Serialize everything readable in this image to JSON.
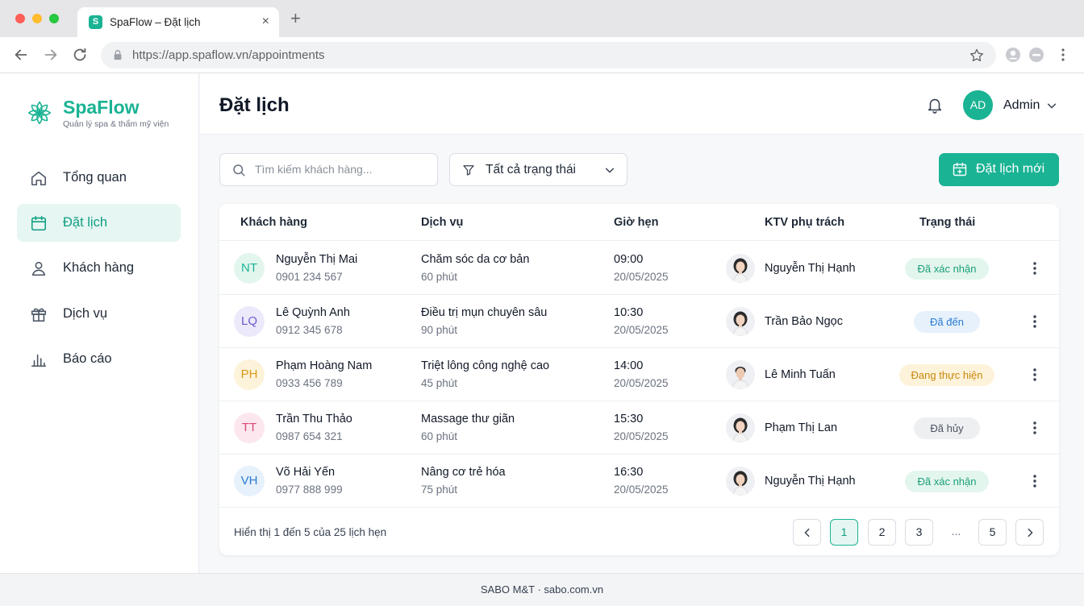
{
  "browser": {
    "tab_title": "SpaFlow – Đặt lịch",
    "tab_favicon_letter": "S",
    "url": "https://app.spaflow.vn/appointments"
  },
  "sidebar": {
    "brand": "SpaFlow",
    "tagline": "Quản lý spa & thẩm mỹ viện",
    "items": [
      {
        "label": "Tổng quan",
        "icon": "home-icon",
        "active": false
      },
      {
        "label": "Đặt lịch",
        "icon": "calendar-icon",
        "active": true
      },
      {
        "label": "Khách hàng",
        "icon": "user-icon",
        "active": false
      },
      {
        "label": "Dịch vụ",
        "icon": "gift-icon",
        "active": false
      },
      {
        "label": "Báo cáo",
        "icon": "bar-chart-icon",
        "active": false
      }
    ]
  },
  "header": {
    "title": "Đặt lịch",
    "user_initials": "AD",
    "user_name": "Admin"
  },
  "toolbar": {
    "search_placeholder": "Tìm kiếm khách hàng...",
    "filter_label": "Tất cả trạng thái",
    "new_button": "Đặt lịch mới"
  },
  "table": {
    "columns": [
      "Khách hàng",
      "Dịch vụ",
      "Giờ hẹn",
      "KTV phụ trách",
      "Trạng thái"
    ],
    "rows": [
      {
        "initials": "NT",
        "name": "Nguyễn Thị Mai",
        "phone": "0901 234 567",
        "service": "Chăm sóc da cơ bản",
        "duration": "60 phút",
        "time": "09:00",
        "date": "20/05/2025",
        "staff": "Nguyễn Thị Hạnh",
        "status": "Đã xác nhận"
      },
      {
        "initials": "LQ",
        "name": "Lê Quỳnh Anh",
        "phone": "0912 345 678",
        "service": "Điều trị mụn chuyên sâu",
        "duration": "90 phút",
        "time": "10:30",
        "date": "20/05/2025",
        "staff": "Trần Bảo Ngọc",
        "status": "Đã đến"
      },
      {
        "initials": "PH",
        "name": "Phạm Hoàng Nam",
        "phone": "0933 456 789",
        "service": "Triệt lông công nghệ cao",
        "duration": "45 phút",
        "time": "14:00",
        "date": "20/05/2025",
        "staff": "Lê Minh Tuấn",
        "status": "Đang thực hiện"
      },
      {
        "initials": "TT",
        "name": "Trần Thu Thảo",
        "phone": "0987 654 321",
        "service": "Massage thư giãn",
        "duration": "60 phút",
        "time": "15:30",
        "date": "20/05/2025",
        "staff": "Phạm Thị Lan",
        "status": "Đã hủy"
      },
      {
        "initials": "VH",
        "name": "Võ Hải Yến",
        "phone": "0977 888 999",
        "service": "Nâng cơ trẻ hóa",
        "duration": "75 phút",
        "time": "16:30",
        "date": "20/05/2025",
        "staff": "Nguyễn Thị Hạnh",
        "status": "Đã xác nhận"
      }
    ],
    "summary": "Hiển thị 1 đến 5 của 25 lịch hẹn",
    "pages": [
      "1",
      "2",
      "3",
      "...",
      "5"
    ]
  },
  "footer": "SABO M&T · sabo.com.vn",
  "colors": {
    "accent": "#1ab394",
    "status_confirmed": "#e3f6ee",
    "status_arrived": "#e6f1fb",
    "status_in_progress": "#fdf3da",
    "status_cancelled": "#eeeff1"
  }
}
